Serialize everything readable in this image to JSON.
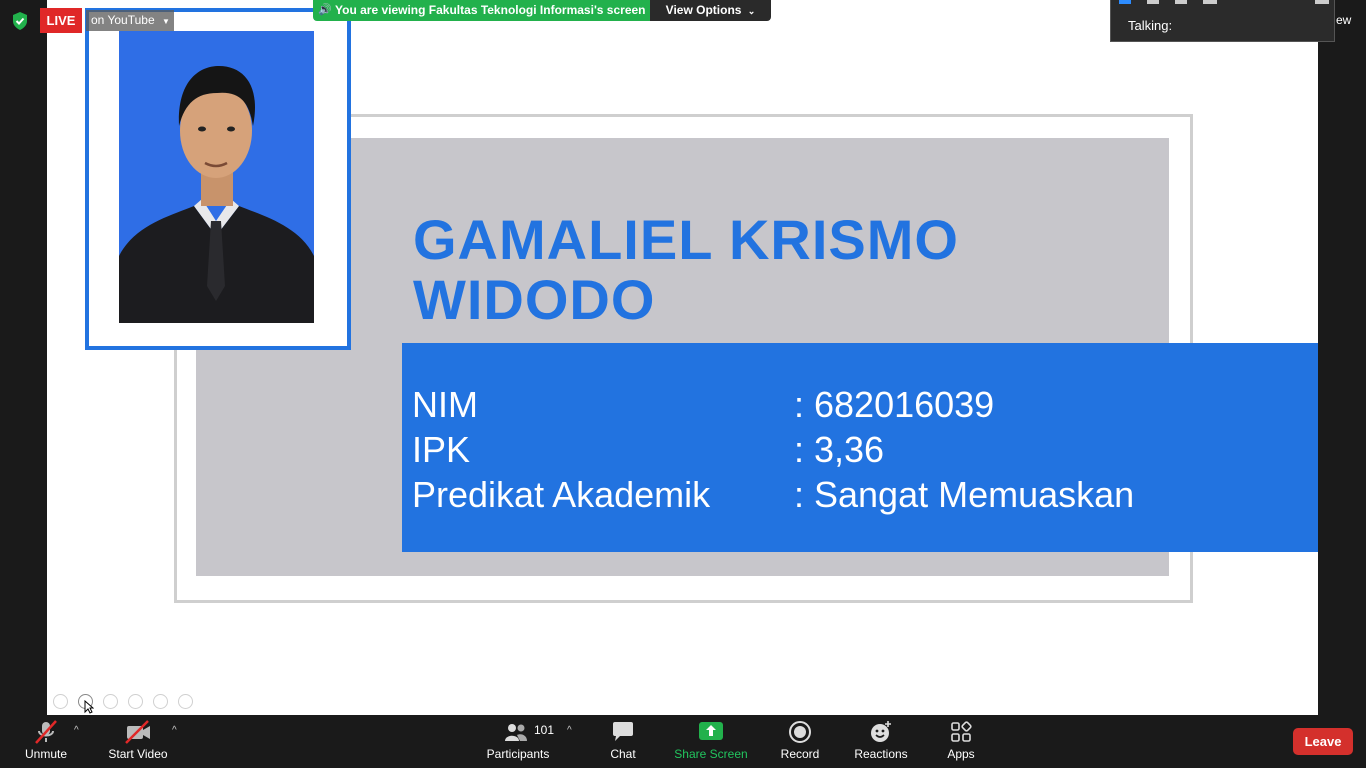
{
  "top": {
    "live_label": "LIVE",
    "youtube_label": "on YouTube",
    "banner_text": "You are viewing Fakultas Teknologi Informasi's screen",
    "view_options_label": "View Options",
    "talking_label": "Talking:",
    "partial_view_label": "ew"
  },
  "slide": {
    "name_line1": "GAMALIEL KRISMO",
    "name_line2": "WIDODO",
    "rows": [
      {
        "key": "NIM",
        "value": ": 682016039"
      },
      {
        "key": "IPK",
        "value": ": 3,36"
      },
      {
        "key": "Predikat Akademik",
        "value": ": Sangat Memuaskan"
      }
    ]
  },
  "toolbar": {
    "unmute": "Unmute",
    "start_video": "Start Video",
    "participants": "Participants",
    "participants_count": "101",
    "chat": "Chat",
    "share_screen": "Share Screen",
    "record": "Record",
    "reactions": "Reactions",
    "apps": "Apps",
    "leave": "Leave"
  },
  "colors": {
    "accent_blue": "#2273e0",
    "live_red": "#e02828",
    "share_green": "#22b14c",
    "leave_red": "#d4302c"
  }
}
